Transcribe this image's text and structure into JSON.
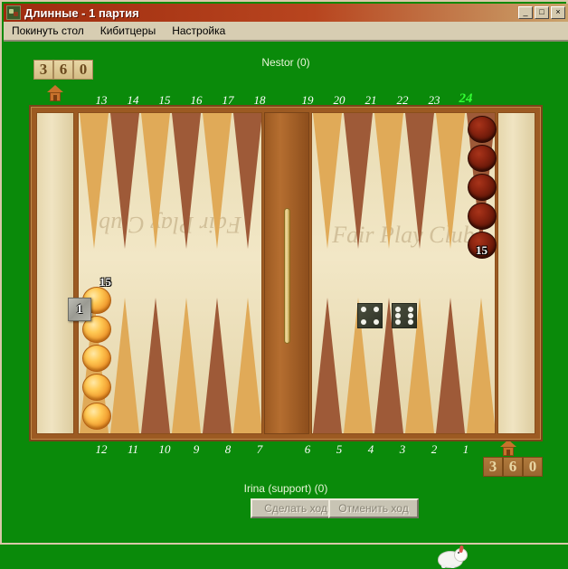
{
  "window": {
    "title": "Длинные - 1 партия",
    "icon": "board-game-icon",
    "minimize_label": "_",
    "maximize_label": "□",
    "close_label": "×"
  },
  "menu": {
    "items": [
      {
        "label": "Покинуть стол",
        "name": "menu-leave-table"
      },
      {
        "label": "Кибитцеры",
        "name": "menu-kibitzers"
      },
      {
        "label": "Настройка",
        "name": "menu-settings"
      }
    ]
  },
  "players": {
    "top": "Nestor (0)",
    "bottom": "Irina (support) (0)"
  },
  "counters": {
    "top": {
      "digits": [
        "3",
        "6",
        "0"
      ],
      "value": "360"
    },
    "bottom": {
      "digits": [
        "3",
        "6",
        "0"
      ],
      "value": "360"
    }
  },
  "home_icons": {
    "top": "home-icon",
    "bottom": "home-icon"
  },
  "point_numbers": {
    "top": [
      "13",
      "14",
      "15",
      "16",
      "17",
      "18",
      "19",
      "20",
      "21",
      "22",
      "23",
      "24"
    ],
    "bottom": [
      "12",
      "11",
      "10",
      "9",
      "8",
      "7",
      "6",
      "5",
      "4",
      "3",
      "2",
      "1"
    ],
    "highlighted": "24"
  },
  "board": {
    "watermark": "Fair Play Club",
    "doubling_cube": {
      "value": "1"
    },
    "stacks": [
      {
        "point": "24",
        "color": "red",
        "count": "15"
      },
      {
        "point": "12",
        "color": "gold",
        "count": "15"
      }
    ],
    "dice": [
      {
        "name": "die-left",
        "value": 4
      },
      {
        "name": "die-right",
        "value": 6
      }
    ]
  },
  "controls": {
    "move_label": "Сделать ход",
    "undo_label": "Отменить ход",
    "move_enabled": false,
    "undo_enabled": false
  },
  "mascot": "sheep-mascot-icon",
  "colors": {
    "felt": "#0a8a0a",
    "title_bar": "#9e2b0e",
    "menu_bar": "#d7cdb2",
    "board_frame": "#9c5a22",
    "point_light": "#e0aa58",
    "point_dark": "#9e5a38",
    "checker_gold": "#f0982c",
    "checker_red": "#8a2410",
    "highlight_number": "#33ff33"
  }
}
